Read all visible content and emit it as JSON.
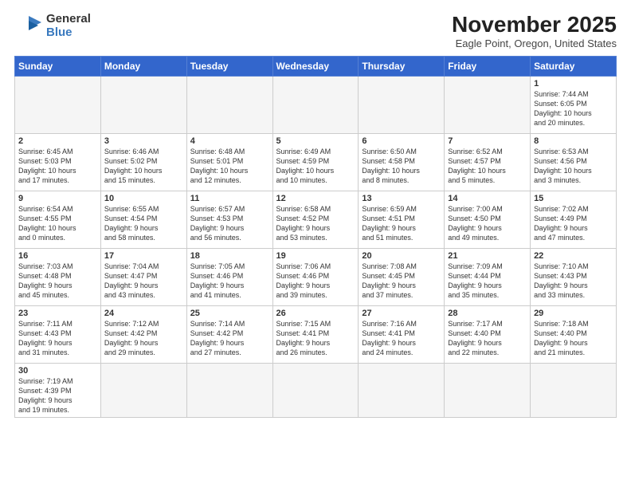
{
  "header": {
    "logo_general": "General",
    "logo_blue": "Blue",
    "month_title": "November 2025",
    "location": "Eagle Point, Oregon, United States"
  },
  "weekdays": [
    "Sunday",
    "Monday",
    "Tuesday",
    "Wednesday",
    "Thursday",
    "Friday",
    "Saturday"
  ],
  "weeks": [
    [
      {
        "day": "",
        "info": ""
      },
      {
        "day": "",
        "info": ""
      },
      {
        "day": "",
        "info": ""
      },
      {
        "day": "",
        "info": ""
      },
      {
        "day": "",
        "info": ""
      },
      {
        "day": "",
        "info": ""
      },
      {
        "day": "1",
        "info": "Sunrise: 7:44 AM\nSunset: 6:05 PM\nDaylight: 10 hours\nand 20 minutes."
      }
    ],
    [
      {
        "day": "2",
        "info": "Sunrise: 6:45 AM\nSunset: 5:03 PM\nDaylight: 10 hours\nand 17 minutes."
      },
      {
        "day": "3",
        "info": "Sunrise: 6:46 AM\nSunset: 5:02 PM\nDaylight: 10 hours\nand 15 minutes."
      },
      {
        "day": "4",
        "info": "Sunrise: 6:48 AM\nSunset: 5:01 PM\nDaylight: 10 hours\nand 12 minutes."
      },
      {
        "day": "5",
        "info": "Sunrise: 6:49 AM\nSunset: 4:59 PM\nDaylight: 10 hours\nand 10 minutes."
      },
      {
        "day": "6",
        "info": "Sunrise: 6:50 AM\nSunset: 4:58 PM\nDaylight: 10 hours\nand 8 minutes."
      },
      {
        "day": "7",
        "info": "Sunrise: 6:52 AM\nSunset: 4:57 PM\nDaylight: 10 hours\nand 5 minutes."
      },
      {
        "day": "8",
        "info": "Sunrise: 6:53 AM\nSunset: 4:56 PM\nDaylight: 10 hours\nand 3 minutes."
      }
    ],
    [
      {
        "day": "9",
        "info": "Sunrise: 6:54 AM\nSunset: 4:55 PM\nDaylight: 10 hours\nand 0 minutes."
      },
      {
        "day": "10",
        "info": "Sunrise: 6:55 AM\nSunset: 4:54 PM\nDaylight: 9 hours\nand 58 minutes."
      },
      {
        "day": "11",
        "info": "Sunrise: 6:57 AM\nSunset: 4:53 PM\nDaylight: 9 hours\nand 56 minutes."
      },
      {
        "day": "12",
        "info": "Sunrise: 6:58 AM\nSunset: 4:52 PM\nDaylight: 9 hours\nand 53 minutes."
      },
      {
        "day": "13",
        "info": "Sunrise: 6:59 AM\nSunset: 4:51 PM\nDaylight: 9 hours\nand 51 minutes."
      },
      {
        "day": "14",
        "info": "Sunrise: 7:00 AM\nSunset: 4:50 PM\nDaylight: 9 hours\nand 49 minutes."
      },
      {
        "day": "15",
        "info": "Sunrise: 7:02 AM\nSunset: 4:49 PM\nDaylight: 9 hours\nand 47 minutes."
      }
    ],
    [
      {
        "day": "16",
        "info": "Sunrise: 7:03 AM\nSunset: 4:48 PM\nDaylight: 9 hours\nand 45 minutes."
      },
      {
        "day": "17",
        "info": "Sunrise: 7:04 AM\nSunset: 4:47 PM\nDaylight: 9 hours\nand 43 minutes."
      },
      {
        "day": "18",
        "info": "Sunrise: 7:05 AM\nSunset: 4:46 PM\nDaylight: 9 hours\nand 41 minutes."
      },
      {
        "day": "19",
        "info": "Sunrise: 7:06 AM\nSunset: 4:46 PM\nDaylight: 9 hours\nand 39 minutes."
      },
      {
        "day": "20",
        "info": "Sunrise: 7:08 AM\nSunset: 4:45 PM\nDaylight: 9 hours\nand 37 minutes."
      },
      {
        "day": "21",
        "info": "Sunrise: 7:09 AM\nSunset: 4:44 PM\nDaylight: 9 hours\nand 35 minutes."
      },
      {
        "day": "22",
        "info": "Sunrise: 7:10 AM\nSunset: 4:43 PM\nDaylight: 9 hours\nand 33 minutes."
      }
    ],
    [
      {
        "day": "23",
        "info": "Sunrise: 7:11 AM\nSunset: 4:43 PM\nDaylight: 9 hours\nand 31 minutes."
      },
      {
        "day": "24",
        "info": "Sunrise: 7:12 AM\nSunset: 4:42 PM\nDaylight: 9 hours\nand 29 minutes."
      },
      {
        "day": "25",
        "info": "Sunrise: 7:14 AM\nSunset: 4:42 PM\nDaylight: 9 hours\nand 27 minutes."
      },
      {
        "day": "26",
        "info": "Sunrise: 7:15 AM\nSunset: 4:41 PM\nDaylight: 9 hours\nand 26 minutes."
      },
      {
        "day": "27",
        "info": "Sunrise: 7:16 AM\nSunset: 4:41 PM\nDaylight: 9 hours\nand 24 minutes."
      },
      {
        "day": "28",
        "info": "Sunrise: 7:17 AM\nSunset: 4:40 PM\nDaylight: 9 hours\nand 22 minutes."
      },
      {
        "day": "29",
        "info": "Sunrise: 7:18 AM\nSunset: 4:40 PM\nDaylight: 9 hours\nand 21 minutes."
      }
    ],
    [
      {
        "day": "30",
        "info": "Sunrise: 7:19 AM\nSunset: 4:39 PM\nDaylight: 9 hours\nand 19 minutes."
      },
      {
        "day": "",
        "info": ""
      },
      {
        "day": "",
        "info": ""
      },
      {
        "day": "",
        "info": ""
      },
      {
        "day": "",
        "info": ""
      },
      {
        "day": "",
        "info": ""
      },
      {
        "day": "",
        "info": ""
      }
    ]
  ]
}
